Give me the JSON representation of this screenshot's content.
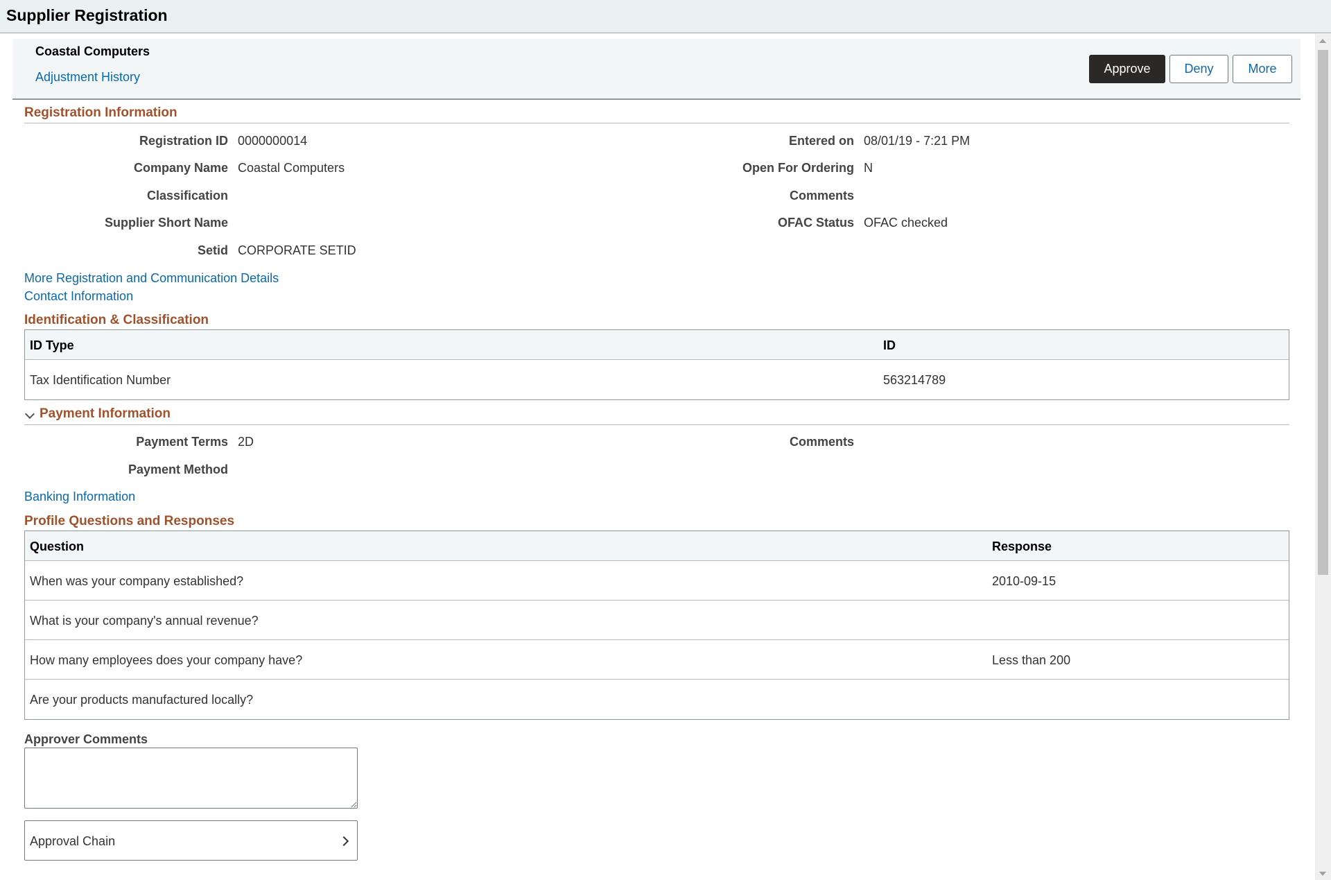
{
  "page": {
    "title": "Supplier Registration"
  },
  "header": {
    "company": "Coastal Computers",
    "adjustment_link": "Adjustment History",
    "approve_label": "Approve",
    "deny_label": "Deny",
    "more_label": "More"
  },
  "registration": {
    "title": "Registration Information",
    "fields": {
      "registration_id": {
        "label": "Registration ID",
        "value": "0000000014"
      },
      "company_name": {
        "label": "Company Name",
        "value": "Coastal Computers"
      },
      "classification": {
        "label": "Classification",
        "value": ""
      },
      "supplier_short_name": {
        "label": "Supplier Short Name",
        "value": ""
      },
      "setid": {
        "label": "Setid",
        "value": "CORPORATE SETID"
      },
      "entered_on": {
        "label": "Entered on",
        "value": "08/01/19 - 7:21 PM"
      },
      "open_for_ordering": {
        "label": "Open For Ordering",
        "value": "N"
      },
      "comments": {
        "label": "Comments",
        "value": ""
      },
      "ofac_status": {
        "label": "OFAC Status",
        "value": "OFAC checked"
      }
    },
    "more_details_link": "More Registration and Communication Details",
    "contact_link": "Contact Information"
  },
  "identification": {
    "title": "Identification & Classification",
    "columns": [
      "ID Type",
      "ID"
    ],
    "rows": [
      {
        "id_type": "Tax Identification Number",
        "id": "563214789"
      }
    ]
  },
  "payment": {
    "title": "Payment Information",
    "fields": {
      "payment_terms": {
        "label": "Payment Terms",
        "value": "2D"
      },
      "payment_method": {
        "label": "Payment Method",
        "value": ""
      },
      "comments": {
        "label": "Comments",
        "value": ""
      }
    },
    "banking_link": "Banking Information"
  },
  "profile": {
    "title": "Profile Questions and Responses",
    "columns": [
      "Question",
      "Response"
    ],
    "rows": [
      {
        "question": "When was your company established?",
        "response": "2010-09-15"
      },
      {
        "question": "What is your company's annual revenue?",
        "response": ""
      },
      {
        "question": "How many employees does your company have?",
        "response": "Less than 200"
      },
      {
        "question": "Are your products manufactured locally?",
        "response": ""
      }
    ]
  },
  "approver": {
    "comments_label": "Approver Comments",
    "comments_value": "",
    "chain_label": "Approval Chain"
  },
  "icons": {
    "payment_toggle": "chevron-down-icon",
    "approval_chain": "chevron-right-icon"
  }
}
